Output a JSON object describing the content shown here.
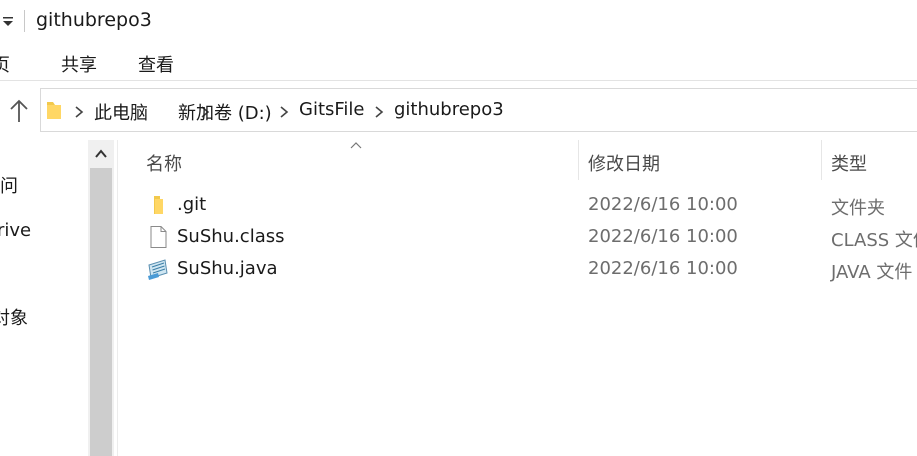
{
  "window": {
    "title": "githubrepo3"
  },
  "ribbon": {
    "tabs": [
      "页",
      "共享",
      "查看"
    ]
  },
  "address_bar": {
    "crumbs": [
      "此电脑",
      "新加卷 (D:)",
      "GitsFile",
      "githubrepo3"
    ]
  },
  "nav_pane": {
    "items": [
      "问",
      "rive",
      "对象"
    ]
  },
  "file_list": {
    "columns": {
      "name": "名称",
      "date_modified": "修改日期",
      "type": "类型"
    },
    "rows": [
      {
        "name": ".git",
        "date_modified": "2022/6/16 10:00",
        "type": "文件夹",
        "icon": "folder-icon"
      },
      {
        "name": "SuShu.class",
        "date_modified": "2022/6/16 10:00",
        "type": "CLASS 文件",
        "icon": "file-icon"
      },
      {
        "name": "SuShu.java",
        "date_modified": "2022/6/16 10:00",
        "type": "JAVA 文件",
        "icon": "java-file-icon"
      }
    ]
  },
  "colors": {
    "folder": "#ffd765",
    "scrollbar_thumb": "#cdcdcd",
    "secondary_text": "#6d6d6d"
  }
}
